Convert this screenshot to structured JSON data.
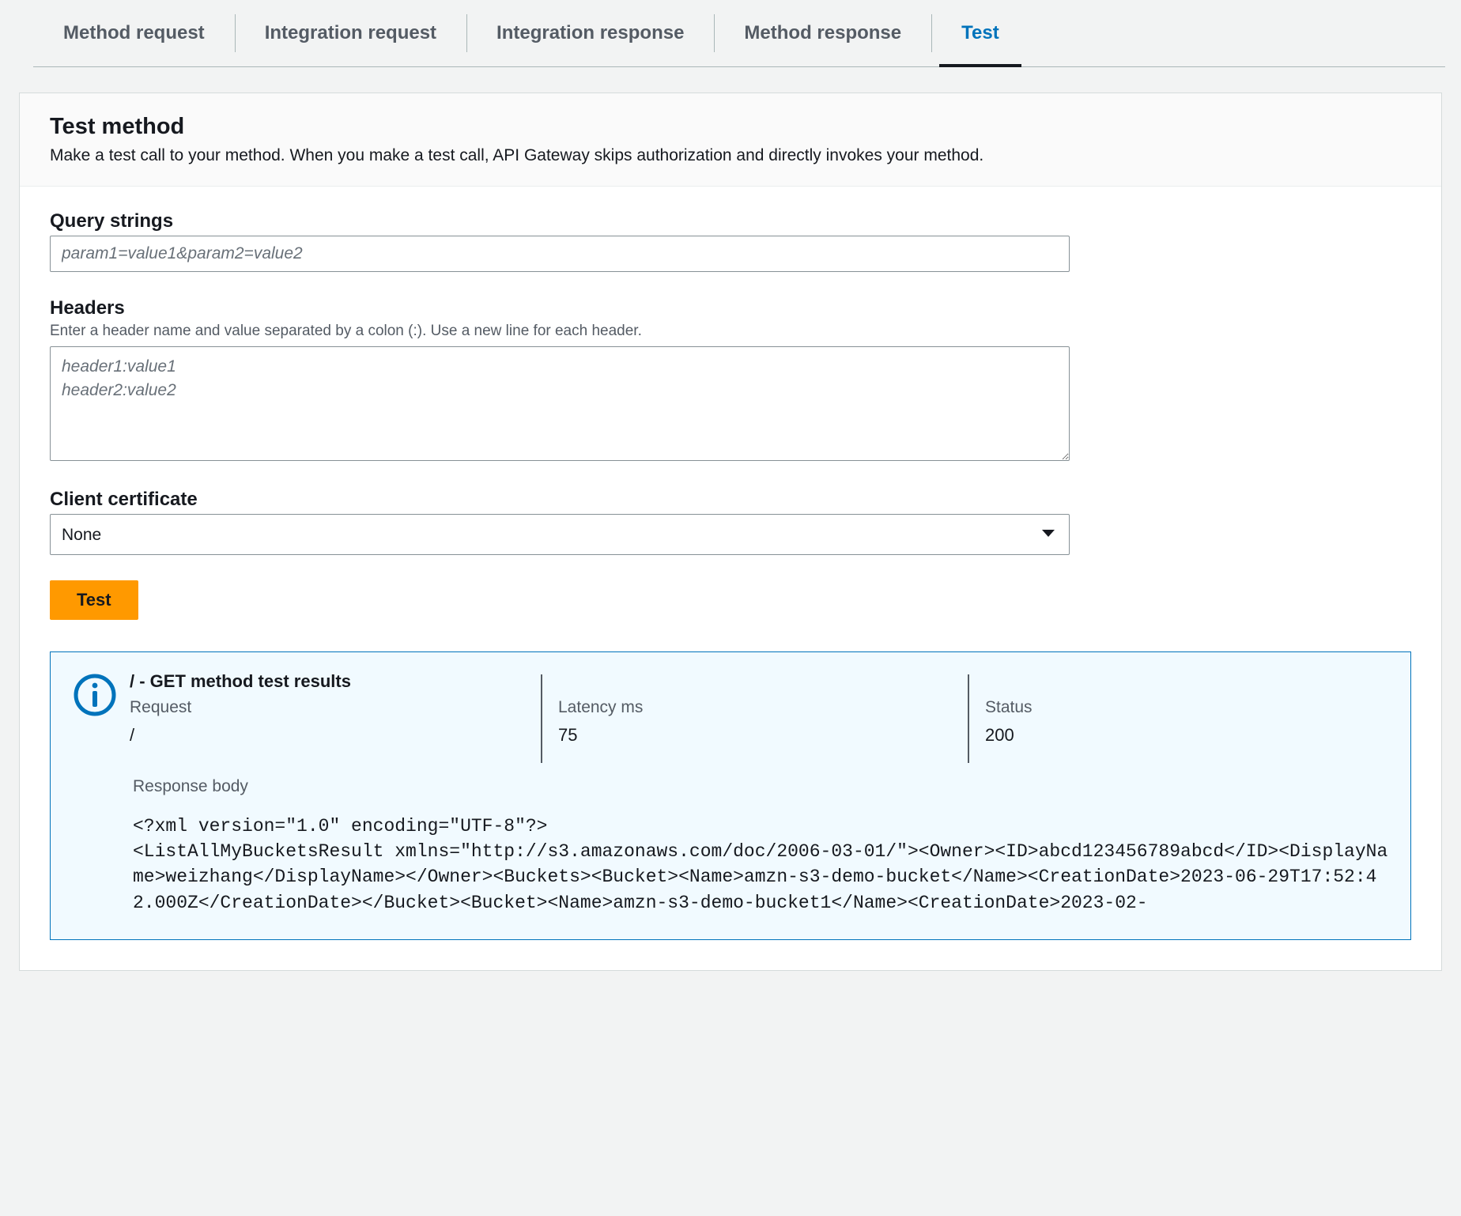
{
  "tabs": [
    {
      "label": "Method request",
      "active": false
    },
    {
      "label": "Integration request",
      "active": false
    },
    {
      "label": "Integration response",
      "active": false
    },
    {
      "label": "Method response",
      "active": false
    },
    {
      "label": "Test",
      "active": true
    }
  ],
  "panel": {
    "title": "Test method",
    "description": "Make a test call to your method. When you make a test call, API Gateway skips authorization and directly invokes your method."
  },
  "fields": {
    "query": {
      "label": "Query strings",
      "placeholder": "param1=value1&param2=value2",
      "value": ""
    },
    "headers": {
      "label": "Headers",
      "help": "Enter a header name and value separated by a colon (:). Use a new line for each header.",
      "placeholder": "header1:value1\nheader2:value2",
      "value": ""
    },
    "clientCert": {
      "label": "Client certificate",
      "selected": "None"
    }
  },
  "buttons": {
    "test": "Test"
  },
  "result": {
    "title": "/ - GET method test results",
    "requestLabel": "Request",
    "requestValue": "/",
    "latencyLabel": "Latency ms",
    "latencyValue": "75",
    "statusLabel": "Status",
    "statusValue": "200",
    "responseBodyLabel": "Response body",
    "responseBody": "<?xml version=\"1.0\" encoding=\"UTF-8\"?>\n<ListAllMyBucketsResult xmlns=\"http://s3.amazonaws.com/doc/2006-03-01/\"><Owner><ID>abcd123456789abcd</ID><DisplayName>weizhang</DisplayName></Owner><Buckets><Bucket><Name>amzn-s3-demo-bucket</Name><CreationDate>2023-06-29T17:52:42.000Z</CreationDate></Bucket><Bucket><Name>amzn-s3-demo-bucket1</Name><CreationDate>2023-02-"
  }
}
